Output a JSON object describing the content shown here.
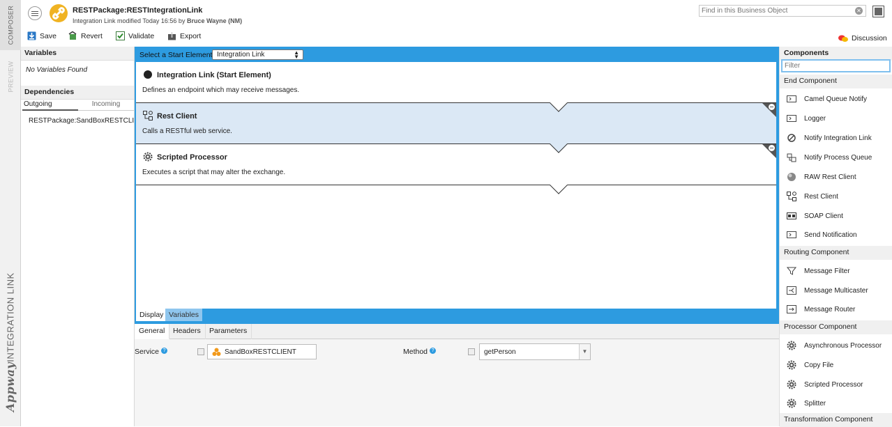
{
  "sidebar_tabs": {
    "composer": "COMPOSER",
    "preview": "PREVIEW",
    "integration_link": "INTEGRATION LINK",
    "brand": "Appway"
  },
  "header": {
    "title": "RESTPackage:RESTIntegrationLink",
    "subtitle_prefix": "Integration Link modified Today 16:56 by",
    "subtitle_user": "Bruce Wayne (NM)",
    "search_placeholder": "Find in this Business Object"
  },
  "toolbar": {
    "save": "Save",
    "revert": "Revert",
    "validate": "Validate",
    "export": "Export",
    "discussion": "Discussion"
  },
  "left_panel": {
    "variables_header": "Variables",
    "no_variables": "No Variables Found",
    "dependencies_header": "Dependencies",
    "tabs": [
      "Outgoing",
      "Incoming"
    ],
    "dependencies": [
      "RESTPackage:SandBoxRESTCLIENT"
    ]
  },
  "editor": {
    "start_label": "Select a Start Element:",
    "start_value": "Integration Link",
    "elements": [
      {
        "name": "Integration Link (Start Element)",
        "desc": "Defines an endpoint which may receive messages.",
        "icon": "circle-icon"
      },
      {
        "name": "Rest Client",
        "desc": "Calls a RESTful web service.",
        "icon": "rest-client-icon"
      },
      {
        "name": "Scripted Processor",
        "desc": "Executes a script that may alter the exchange.",
        "icon": "gear-icon"
      }
    ],
    "bottom_tabs": [
      "Display",
      "Variables"
    ]
  },
  "properties": {
    "tabs": [
      "General",
      "Headers",
      "Parameters"
    ],
    "service_label": "Service",
    "service_value": "SandBoxRESTCLIENT",
    "method_label": "Method",
    "method_value": "getPerson"
  },
  "components": {
    "header": "Components",
    "filter_placeholder": "Filter",
    "groups": [
      {
        "name": "End Component",
        "items": [
          "Camel Queue Notify",
          "Logger",
          "Notify Integration Link",
          "Notify Process Queue",
          "RAW Rest Client",
          "Rest Client",
          "SOAP Client",
          "Send Notification"
        ]
      },
      {
        "name": "Routing Component",
        "items": [
          "Message Filter",
          "Message Multicaster",
          "Message Router"
        ]
      },
      {
        "name": "Processor Component",
        "items": [
          "Asynchronous Processor",
          "Copy File",
          "Scripted Processor",
          "Splitter"
        ]
      },
      {
        "name": "Transformation Component",
        "items": []
      }
    ]
  },
  "colors": {
    "accent": "#2d9be0",
    "selected_row": "#dbe8f5",
    "link_gold": "#f0b323"
  }
}
